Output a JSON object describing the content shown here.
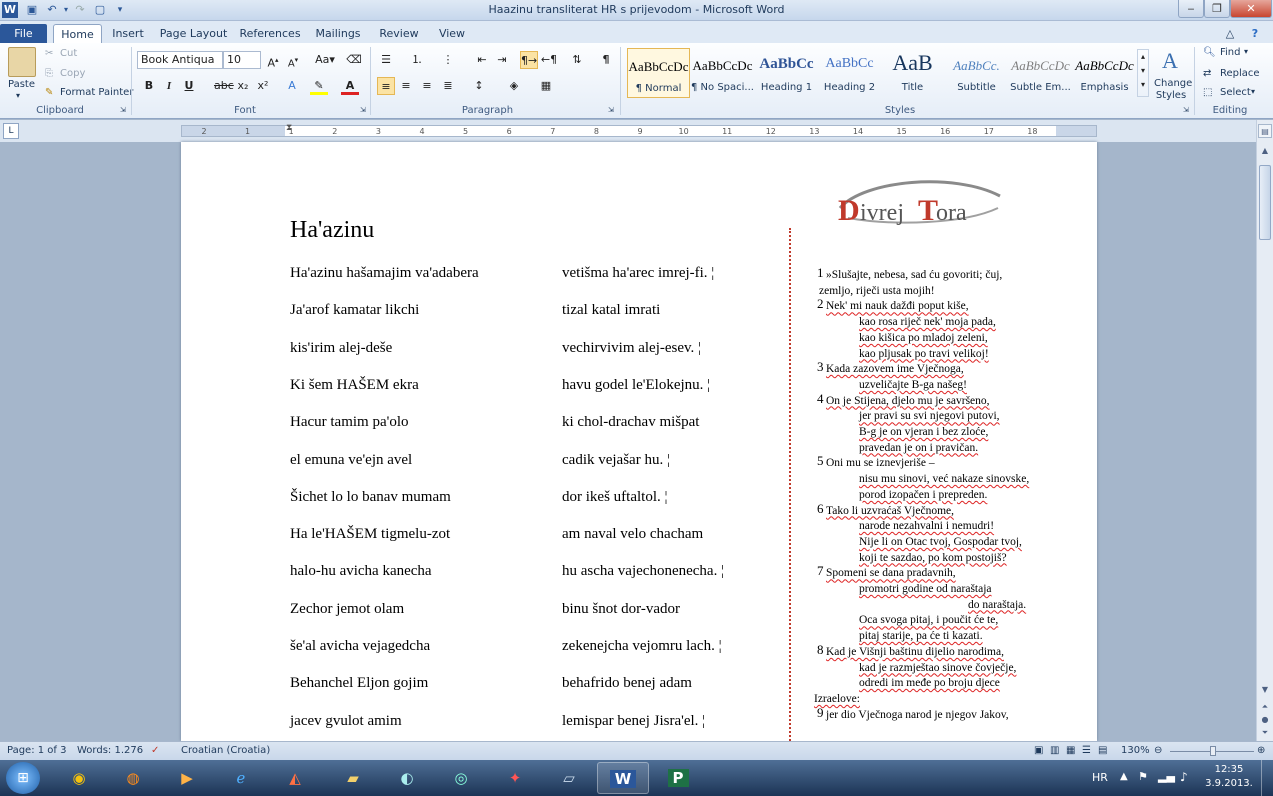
{
  "window": {
    "title": "Haazinu transliterat HR s prijevodom - Microsoft Word"
  },
  "tabs": [
    "File",
    "Home",
    "Insert",
    "Page Layout",
    "References",
    "Mailings",
    "Review",
    "View"
  ],
  "ribbon": {
    "clipboard": {
      "paste": "Paste",
      "cut": "Cut",
      "copy": "Copy",
      "format_painter": "Format Painter",
      "label": "Clipboard"
    },
    "font": {
      "name": "Book Antiqua",
      "size": "10",
      "label": "Font"
    },
    "paragraph": {
      "label": "Paragraph"
    },
    "styles": {
      "items": [
        {
          "sample": "AaBbCcDc",
          "name": "¶ Normal"
        },
        {
          "sample": "AaBbCcDc",
          "name": "¶ No Spaci..."
        },
        {
          "sample": "AaBbCc",
          "name": "Heading 1"
        },
        {
          "sample": "AaBbCc",
          "name": "Heading 2"
        },
        {
          "sample": "AaB",
          "name": "Title"
        },
        {
          "sample": "AaBbCc.",
          "name": "Subtitle"
        },
        {
          "sample": "AaBbCcDc",
          "name": "Subtle Em..."
        },
        {
          "sample": "AaBbCcDc",
          "name": "Emphasis"
        }
      ],
      "change_styles": "Change Styles",
      "label": "Styles"
    },
    "editing": {
      "find": "Find",
      "replace": "Replace",
      "select": "Select",
      "label": "Editing"
    }
  },
  "ruler_ticks": [
    "2",
    "1",
    "1",
    "2",
    "3",
    "4",
    "5",
    "6",
    "7",
    "8",
    "9",
    "10",
    "11",
    "12",
    "13",
    "14",
    "15",
    "16",
    "17",
    "18"
  ],
  "document": {
    "logo_text": "DivrejTora",
    "heading": "Ha'azinu",
    "lines": [
      [
        "Ha'azinu hašamajim va'adabera",
        "vetišma ha'arec imrej-fi. ¦"
      ],
      [
        "Ja'arof kamatar likchi",
        "tizal katal imrati"
      ],
      [
        "kis'irim alej-deše",
        "vechirvivim alej-esev. ¦"
      ],
      [
        "Ki šem HAŠEM ekra",
        "havu godel le'Elokejnu. ¦"
      ],
      [
        "Hacur tamim pa'olo",
        "ki chol-drachav mišpat"
      ],
      [
        "el emuna ve'ejn avel",
        "cadik vejašar hu. ¦"
      ],
      [
        "Šichet lo lo banav mumam",
        "dor ikeš uftaltol. ¦"
      ],
      [
        "Ha le'HAŠEM tigmelu-zot",
        "am naval velo chacham"
      ],
      [
        "halo-hu avicha kanecha",
        "hu ascha vajechonenecha. ¦"
      ],
      [
        "Zechor jemot olam",
        "binu šnot dor-vador"
      ],
      [
        "še'al avicha vejagedcha",
        "zekenejcha vejomru lach. ¦"
      ],
      [
        "Behanchel Eljon gojim",
        "behafrido benej adam"
      ],
      [
        "jacev gvulot amim",
        "lemispar benej Jisra'el. ¦"
      ]
    ],
    "translation": [
      {
        "num": "1",
        "text": "»Slušajte, nebesa, sad ću govoriti; čuj,"
      },
      {
        "num": "",
        "text": "zemljo, riječi usta mojih!"
      },
      {
        "num": "2",
        "text": "Nek' mi nauk dažđi poput kiše,"
      },
      {
        "num": "",
        "text": "kao rosa riječ nek' moja pada,"
      },
      {
        "num": "",
        "text": "kao kišica po mladoj zeleni,"
      },
      {
        "num": "",
        "text": "kao pljusak po travi velikoj!"
      },
      {
        "num": "3",
        "text": "Kada zazovem ime Vječnoga,"
      },
      {
        "num": "",
        "text": "uzveličajte B-ga našeg!"
      },
      {
        "num": "4",
        "text": "On je Stijena, djelo mu je savršeno,"
      },
      {
        "num": "",
        "text": "jer pravi su svi njegovi putovi,"
      },
      {
        "num": "",
        "text": "B-g je on vjeran i bez zloće,"
      },
      {
        "num": "",
        "text": "pravedan je on i pravičan."
      },
      {
        "num": "5",
        "text": "Oni mu se iznevjeriše –"
      },
      {
        "num": "",
        "text": "nisu mu sinovi, već nakaze sinovske,"
      },
      {
        "num": "",
        "text": "porod izopačen i prepreden."
      },
      {
        "num": "6",
        "text": "Tako li uzvraćaš Vječnome,"
      },
      {
        "num": "",
        "text": "narode nezahvalni i nemudri!"
      },
      {
        "num": "",
        "text": "Nije li on Otac tvoj, Gospodar tvoj,"
      },
      {
        "num": "",
        "text": "koji te sazdao, po kom postojiš?"
      },
      {
        "num": "7",
        "text": "Spomeni se dana pradavnih,"
      },
      {
        "num": "",
        "text": "promotri godine od naraštaja"
      },
      {
        "num": "",
        "text": "do naraštaja."
      },
      {
        "num": "",
        "text": "Oca svoga pitaj, i poučit će te,"
      },
      {
        "num": "",
        "text": "pitaj starije, pa će ti kazati."
      },
      {
        "num": "8",
        "text": "Kad je Višnji baštinu dijelio narodima,"
      },
      {
        "num": "",
        "text": "kad je razmještao sinove čovječje,"
      },
      {
        "num": "",
        "text": "odredi im međe po broju djece"
      },
      {
        "num": "",
        "text": "Izraelove:"
      },
      {
        "num": "9",
        "text": "jer dio Vječnoga narod je njegov Jakov,"
      }
    ]
  },
  "status": {
    "page": "Page: 1 of 3",
    "words": "Words: 1.276",
    "language": "Croatian (Croatia)",
    "zoom": "130%"
  },
  "taskbar": {
    "lang": "HR",
    "time": "12:35",
    "date": "3.9.2013."
  },
  "colors": {
    "ribbon_blue": "#2b579a",
    "spell_red": "#dd2222",
    "divider_red": "#c0392b"
  }
}
